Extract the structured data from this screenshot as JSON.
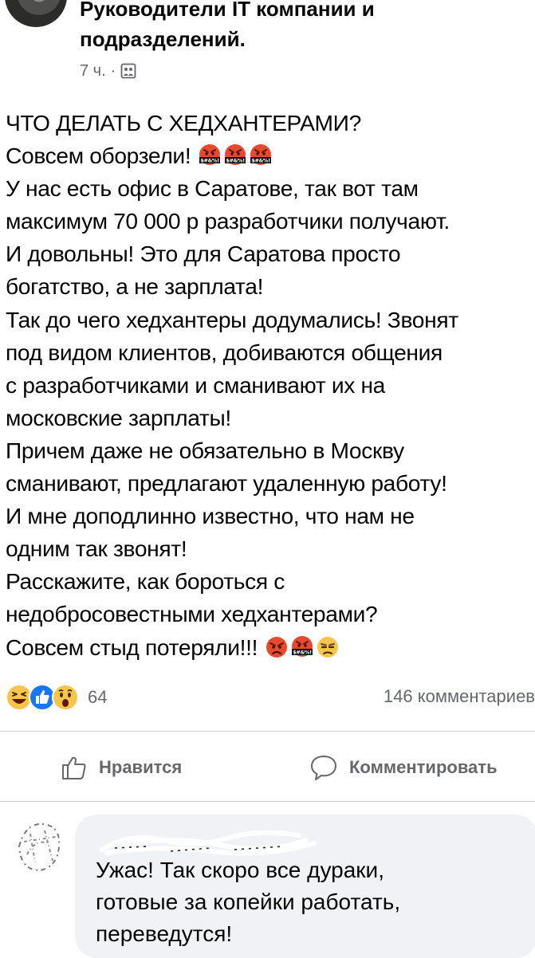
{
  "post": {
    "group_name_lines": [
      "Руководители IT компании и",
      "подразделений."
    ],
    "time": "7 ч.",
    "separator": "·",
    "privacy_icon": "group-privacy-icon",
    "lines": [
      "ЧТО ДЕЛАТЬ С ХЕДХАНТЕРАМИ?",
      "Совсем оборзели!",
      "У нас есть офис в Саратове, так вот там",
      "максимум 70 000 р разработчики получают.",
      "И довольны! Это для Саратова просто",
      "богатство, а не зарплата!",
      "Так до чего хедхантеры додумались! Звонят",
      "под видом клиентов, добиваются общения",
      "с разработчиками и сманивают их на",
      "московские зарплаты!",
      "Причем даже не обязательно в Москву",
      "сманивают, предлагают удаленную работу!",
      "И мне доподлинно известно, что нам не",
      "одним так звонят!",
      "Расскажите, как бороться с",
      "недобросовестными хедхантерами?",
      "Совсем стыд потеряли!!!"
    ],
    "line2_emoji": [
      "cursing-face-emoji",
      "cursing-face-emoji",
      "cursing-face-emoji"
    ],
    "last_line_emoji": [
      "pouting-face-emoji",
      "cursing-face-emoji",
      "unamused-face-emoji"
    ]
  },
  "reactions": {
    "icons": [
      "haha-reaction-icon",
      "like-reaction-icon",
      "wow-reaction-icon"
    ],
    "count": "64",
    "comments": "146 комментариев"
  },
  "actions": {
    "like_label": "Нравится",
    "comment_label": "Комментировать"
  },
  "comment": {
    "lines": [
      "Ужас! Так скоро все дураки,",
      "готовые за копейки работать,",
      "переведутся!"
    ]
  },
  "colors": {
    "secondary_text": "#65676b",
    "bubble_bg": "#f0f2f5",
    "divider": "#ced0d4",
    "like_blue": "#1877f2",
    "emoji_yellow": "#f7c54a",
    "cursing_red": "#e64a2e"
  }
}
